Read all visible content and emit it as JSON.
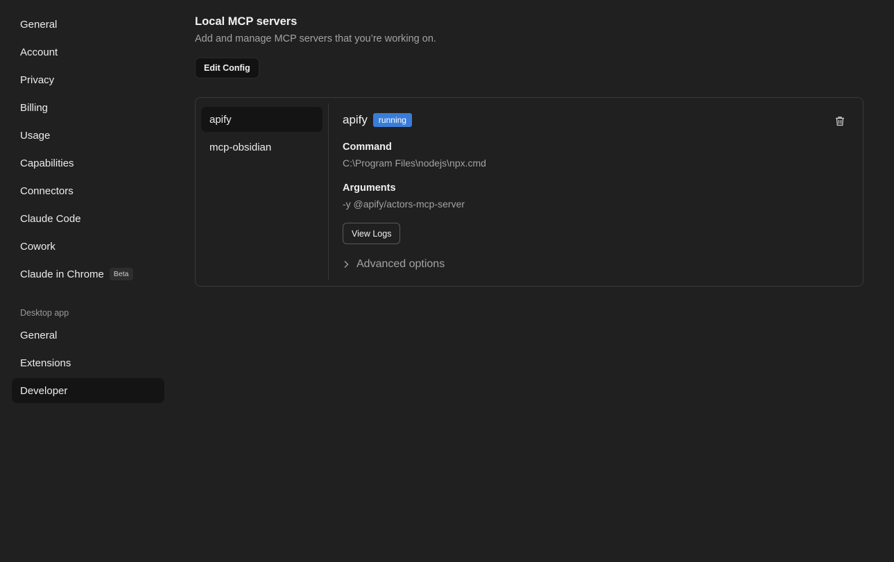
{
  "sidebar": {
    "items": [
      {
        "label": "General"
      },
      {
        "label": "Account"
      },
      {
        "label": "Privacy"
      },
      {
        "label": "Billing"
      },
      {
        "label": "Usage"
      },
      {
        "label": "Capabilities"
      },
      {
        "label": "Connectors"
      },
      {
        "label": "Claude Code"
      },
      {
        "label": "Cowork"
      },
      {
        "label": "Claude in Chrome",
        "badge": "Beta"
      }
    ],
    "desktop_section": {
      "label": "Desktop app",
      "items": [
        {
          "label": "General"
        },
        {
          "label": "Extensions"
        },
        {
          "label": "Developer",
          "active": true
        }
      ]
    }
  },
  "main": {
    "title": "Local MCP servers",
    "subtitle": "Add and manage MCP servers that you’re working on.",
    "edit_config_label": "Edit Config",
    "servers": [
      {
        "name": "apify",
        "active": true
      },
      {
        "name": "mcp-obsidian"
      }
    ],
    "detail": {
      "name": "apify",
      "status": "running",
      "command_label": "Command",
      "command_value": "C:\\Program Files\\nodejs\\npx.cmd",
      "arguments_label": "Arguments",
      "arguments_value": "-y @apify/actors-mcp-server",
      "view_logs_label": "View Logs",
      "advanced_label": "Advanced options",
      "trash_icon": "trash-icon"
    }
  },
  "colors": {
    "background": "#202020",
    "active_bg": "#141414",
    "status_running": "#3a7dd9",
    "muted_text": "#a3a3a3"
  }
}
